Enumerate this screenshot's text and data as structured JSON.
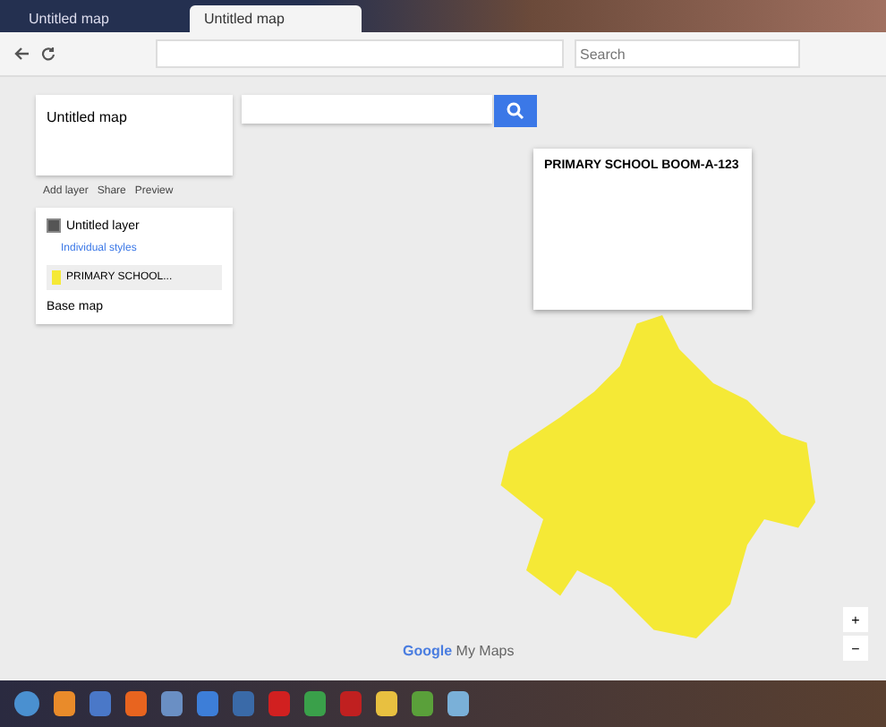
{
  "tabs": [
    {
      "label": "Untitled map",
      "selected": false
    },
    {
      "label": "Untitled map",
      "selected": true
    }
  ],
  "search": {
    "placeholder": "Search"
  },
  "map_panel": {
    "title": "Untitled map",
    "actions": [
      "Add layer",
      "Share",
      "Preview"
    ],
    "layer": {
      "name": "Untitled layer",
      "checked": true,
      "style_link": "Individual styles",
      "features": [
        {
          "name": "PRIMARY SCHOOL...",
          "color": "#f5e936",
          "selected": true
        }
      ]
    },
    "base_map": "Base map"
  },
  "popup": {
    "title": "PRIMARY SCHOOL BOOM-A-123"
  },
  "footer": {
    "logo": "Google",
    "product": "My Maps"
  },
  "zoom_controls": [
    "+",
    "−"
  ]
}
